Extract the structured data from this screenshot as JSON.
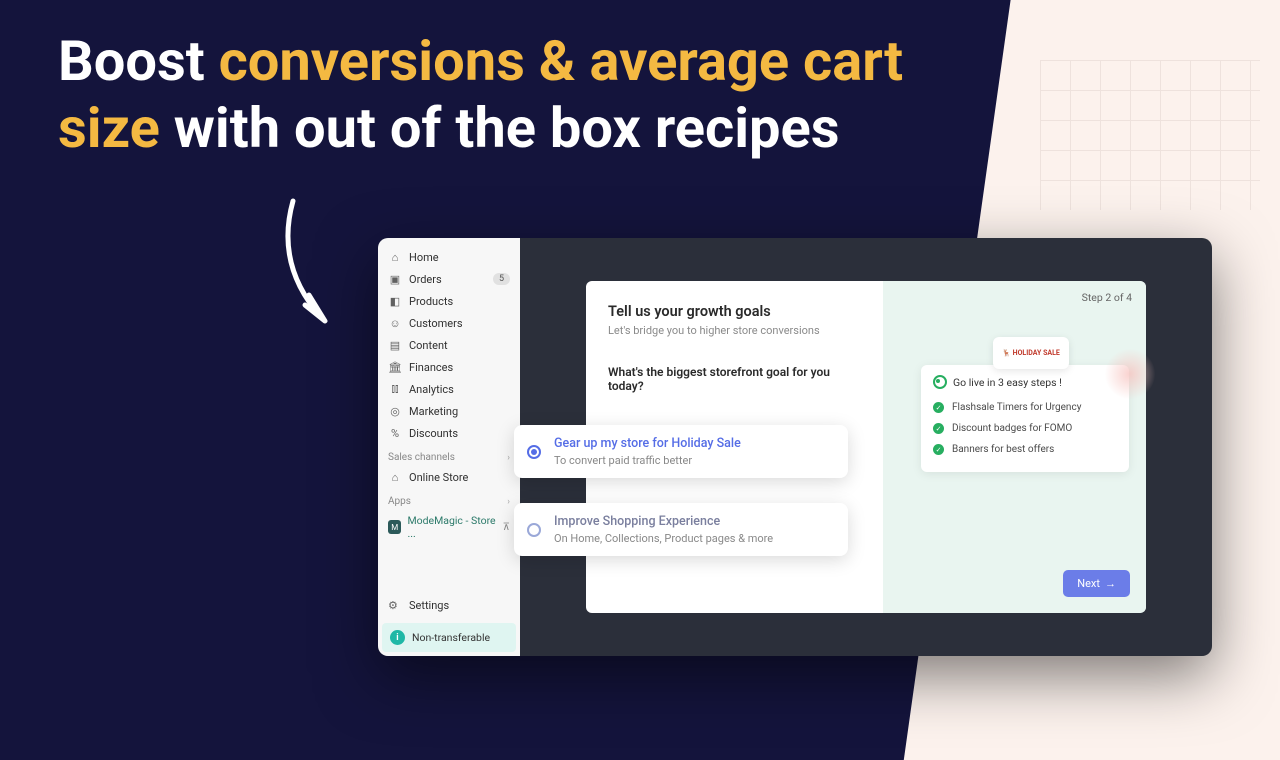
{
  "headline": {
    "part1": "Boost ",
    "accent": "conversions & average cart size",
    "part2": " with out of the box recipes"
  },
  "sidebar": {
    "items": [
      {
        "icon": "⌂",
        "label": "Home"
      },
      {
        "icon": "▣",
        "label": "Orders",
        "badge": "5"
      },
      {
        "icon": "⊞",
        "label": "Products"
      },
      {
        "icon": "☺",
        "label": "Customers"
      },
      {
        "icon": "▤",
        "label": "Content"
      },
      {
        "icon": "𐄷",
        "label": "Finances"
      },
      {
        "icon": "⫿⫿",
        "label": "Analytics"
      },
      {
        "icon": "◎",
        "label": "Marketing"
      },
      {
        "icon": "%",
        "label": "Discounts"
      }
    ],
    "sections": {
      "sales": "Sales channels",
      "apps": "Apps"
    },
    "online_store": "Online Store",
    "app_name": "ModeMagic - Store ...",
    "settings": "Settings",
    "footer": "Non-transferable"
  },
  "dialog": {
    "title": "Tell us your growth goals",
    "subtitle": "Let's bridge you to higher store conversions",
    "question": "What's the biggest storefront goal for you today?",
    "step": "Step 2 of 4",
    "options": [
      {
        "title": "Gear up my store for Holiday Sale",
        "desc": "To convert paid traffic better"
      },
      {
        "title": "Improve Shopping Experience",
        "desc": "On Home, Collections, Product pages & more"
      }
    ],
    "preview": {
      "badge": "HOLIDAY SALE",
      "go": "Go live in 3 easy steps !",
      "items": [
        "Flashsale Timers  for Urgency",
        "Discount badges for FOMO",
        "Banners for best offers"
      ]
    },
    "next": "Next"
  }
}
